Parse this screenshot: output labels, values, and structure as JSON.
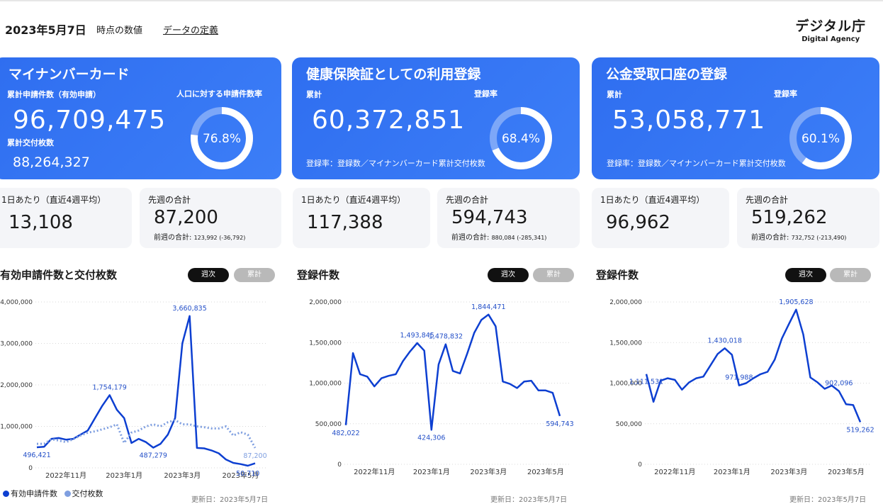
{
  "header": {
    "date": "2023年5月7日",
    "note": "時点の数値",
    "link": "データの定義"
  },
  "logo": {
    "ja": "デジタル庁",
    "en": "Digital Agency"
  },
  "colors": {
    "accent": "#2f6ef0",
    "line_dark": "#0d3fd1",
    "line_light": "#7f9fe0"
  },
  "cards": [
    {
      "title": "マイナンバーカード",
      "label1": "累計申請件数（有効申請）",
      "value1": "96,709,475",
      "label2": "累計交付枚数",
      "value2": "88,264,327",
      "rate_label": "人口に対する申請件数率",
      "rate": "76.8%",
      "rate_value": 0.768
    },
    {
      "title": "健康保険証としての利用登録",
      "label1": "累計",
      "value1": "60,372,851",
      "rate_label": "登録率",
      "rate": "68.4%",
      "rate_value": 0.684,
      "footnote": "登録率：登録数／マイナンバーカード累計交付枚数"
    },
    {
      "title": "公金受取口座の登録",
      "label1": "累計",
      "value1": "53,058,771",
      "rate_label": "登録率",
      "rate": "60.1%",
      "rate_value": 0.601,
      "footnote": "登録率：登録数／マイナンバーカード累計交付枚数"
    }
  ],
  "stats": [
    {
      "daily_label": "1日あたり（直近4週平均）",
      "daily": "13,108",
      "week_label": "先週の合計",
      "week": "87,200",
      "prev_label": "前週の合計:",
      "prev": "123,992 (-36,792)"
    },
    {
      "daily_label": "1日あたり（直近4週平均）",
      "daily": "117,388",
      "week_label": "先週の合計",
      "week": "594,743",
      "prev_label": "前週の合計:",
      "prev": "880,084 (-285,341)"
    },
    {
      "daily_label": "1日あたり（直近4週平均）",
      "daily": "96,962",
      "week_label": "先週の合計",
      "week": "519,262",
      "prev_label": "前週の合計:",
      "prev": "732,752 (-213,490)"
    }
  ],
  "toggles": {
    "weekly": "週次",
    "cumulative": "累計"
  },
  "legend": {
    "series1": "有効申請件数",
    "series2": "交付枚数"
  },
  "updated": "更新日：2023年5月7日",
  "chart_data": [
    {
      "type": "line",
      "title": "有効申請件数と交付枚数",
      "ylim": [
        0,
        4000000
      ],
      "yticks": [
        0,
        1000000,
        2000000,
        3000000,
        4000000
      ],
      "ytick_labels": [
        "0",
        "1,000,000",
        "2,000,000",
        "3,000,000",
        "4,000,000"
      ],
      "xtick_labels": [
        "2022年11月",
        "2023年1月",
        "2023年3月",
        "2023年5月"
      ],
      "xtick_index": [
        4,
        12,
        20,
        28
      ],
      "grid": true,
      "series": [
        {
          "name": "有効申請件数",
          "style": "solid",
          "values": [
            496421,
            510000,
            700000,
            720000,
            680000,
            700000,
            800000,
            900000,
            1200000,
            1500000,
            1754179,
            1400000,
            1200000,
            600000,
            700000,
            620000,
            487279,
            580000,
            800000,
            1200000,
            3000000,
            3660835,
            480000,
            470000,
            420000,
            350000,
            200000,
            120000,
            90000,
            50710,
            110000
          ],
          "labels": [
            {
              "i": 0,
              "text": "496,421"
            },
            {
              "i": 10,
              "text": "1,754,179"
            },
            {
              "i": 16,
              "text": "487,279"
            },
            {
              "i": 21,
              "text": "3,660,835"
            },
            {
              "i": 29,
              "text": "50,710"
            }
          ]
        },
        {
          "name": "交付枚数",
          "style": "dotted",
          "values": [
            580000,
            580000,
            690000,
            660000,
            620000,
            690000,
            780000,
            850000,
            880000,
            930000,
            980000,
            1050000,
            600000,
            850000,
            900000,
            1000000,
            1050000,
            1000000,
            1100000,
            1150000,
            1050000,
            1050000,
            1000000,
            980000,
            950000,
            950000,
            1000000,
            780000,
            860000,
            800000,
            480000
          ],
          "labels": [
            {
              "i": 30,
              "text": "87,200"
            }
          ]
        }
      ]
    },
    {
      "type": "line",
      "title": "登録件数",
      "ylim": [
        0,
        2000000
      ],
      "yticks": [
        0,
        500000,
        1000000,
        1500000,
        2000000
      ],
      "ytick_labels": [
        "0",
        "500,000",
        "1,000,000",
        "1,500,000",
        "2,000,000"
      ],
      "xtick_labels": [
        "2022年11月",
        "2023年1月",
        "2023年3月",
        "2023年5月"
      ],
      "xtick_index": [
        4,
        12,
        20,
        28
      ],
      "grid": true,
      "series": [
        {
          "name": "登録件数",
          "style": "solid",
          "values": [
            482022,
            1370000,
            1110000,
            1080000,
            960000,
            1060000,
            1090000,
            1110000,
            1270000,
            1390000,
            1493845,
            1400000,
            424306,
            1230000,
            1478832,
            1150000,
            1120000,
            1360000,
            1620000,
            1780000,
            1844471,
            1700000,
            1020000,
            990000,
            940000,
            1020000,
            1030000,
            910000,
            910000,
            880000,
            594743
          ],
          "labels": [
            {
              "i": 0,
              "text": "482,022"
            },
            {
              "i": 10,
              "text": "1,493,845"
            },
            {
              "i": 12,
              "text": "424,306"
            },
            {
              "i": 14,
              "text": "1,478,832"
            },
            {
              "i": 20,
              "text": "1,844,471"
            },
            {
              "i": 30,
              "text": "594,743"
            }
          ]
        }
      ]
    },
    {
      "type": "line",
      "title": "登録件数",
      "ylim": [
        0,
        2000000
      ],
      "yticks": [
        0,
        500000,
        1000000,
        1500000,
        2000000
      ],
      "ytick_labels": [
        "0",
        "500,000",
        "1,000,000",
        "1,500,000",
        "2,000,000"
      ],
      "xtick_labels": [
        "2022年11月",
        "2023年1月",
        "2023年3月",
        "2023年5月"
      ],
      "xtick_index": [
        4,
        12,
        20,
        28
      ],
      "grid": true,
      "series": [
        {
          "name": "登録件数",
          "style": "solid",
          "values": [
            1111531,
            770000,
            1030000,
            1060000,
            1040000,
            920000,
            1010000,
            1060000,
            1080000,
            1220000,
            1360000,
            1430018,
            1350000,
            971988,
            1000000,
            1060000,
            1110000,
            1140000,
            1290000,
            1550000,
            1730000,
            1905628,
            1600000,
            1070000,
            1010000,
            930000,
            970000,
            902096,
            740000,
            730000,
            519262
          ],
          "labels": [
            {
              "i": 0,
              "text": "1,111,531"
            },
            {
              "i": 11,
              "text": "1,430,018"
            },
            {
              "i": 13,
              "text": "971,988"
            },
            {
              "i": 21,
              "text": "1,905,628"
            },
            {
              "i": 27,
              "text": "902,096"
            },
            {
              "i": 30,
              "text": "519,262"
            }
          ]
        }
      ]
    }
  ]
}
